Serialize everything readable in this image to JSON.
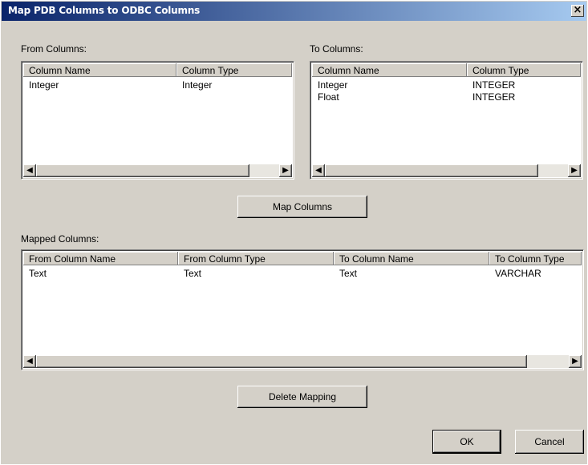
{
  "dialog": {
    "title": "Map PDB Columns to ODBC Columns",
    "close_glyph": "×"
  },
  "from_columns": {
    "label": "From Columns:",
    "headers": [
      "Column Name",
      "Column Type"
    ],
    "rows": [
      [
        "Integer",
        "Integer"
      ]
    ]
  },
  "to_columns": {
    "label": "To Columns:",
    "headers": [
      "Column Name",
      "Column Type"
    ],
    "rows": [
      [
        "Integer",
        "INTEGER"
      ],
      [
        "Float",
        "INTEGER"
      ]
    ]
  },
  "map_button": "Map Columns",
  "mapped_columns": {
    "label": "Mapped Columns:",
    "headers": [
      "From Column Name",
      "From Column Type",
      "To Column Name",
      "To Column Type"
    ],
    "rows": [
      [
        "Text",
        "Text",
        "Text",
        "VARCHAR"
      ]
    ]
  },
  "delete_button": "Delete Mapping",
  "ok_button": "OK",
  "cancel_button": "Cancel",
  "scroll": {
    "left_arrow": "◀",
    "right_arrow": "▶"
  }
}
